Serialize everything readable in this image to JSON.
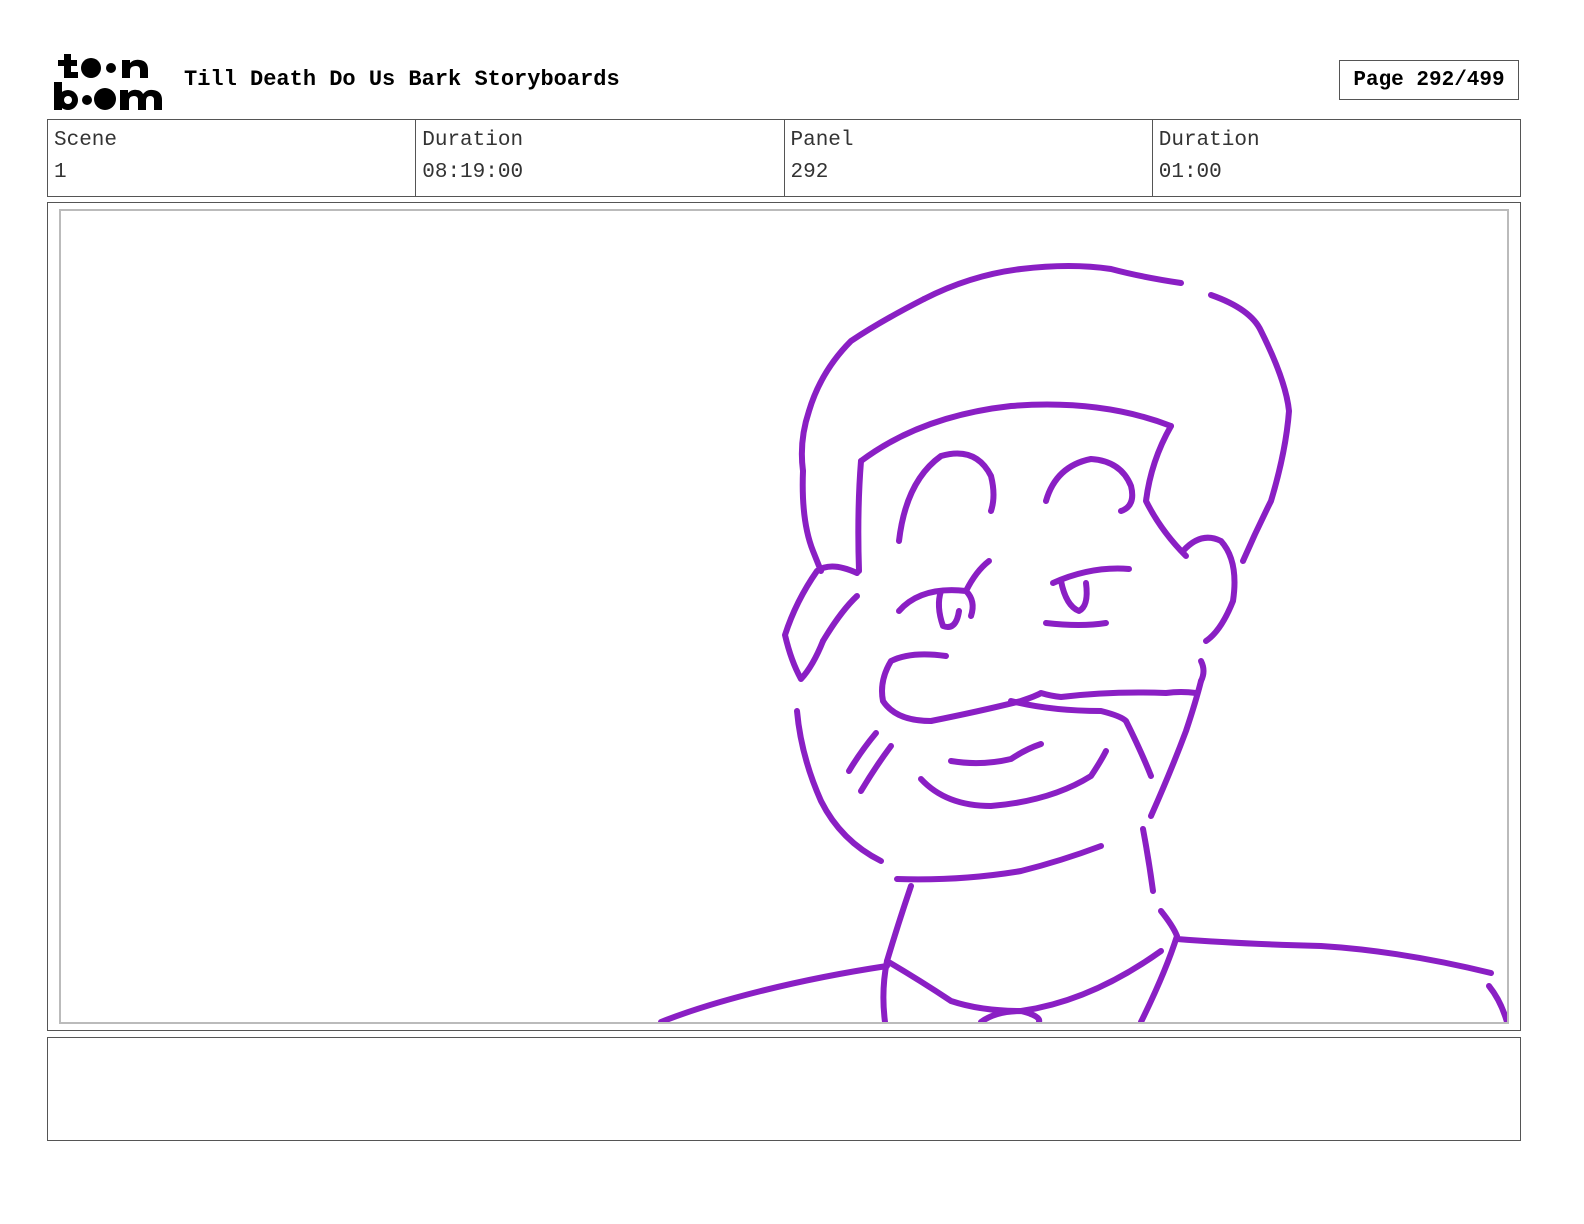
{
  "header": {
    "logo_text": "toon boom",
    "title": "Till Death Do Us Bark Storyboards",
    "page_label": "Page 292/499"
  },
  "info": [
    {
      "label": "Scene",
      "value": "1"
    },
    {
      "label": "Duration",
      "value": "08:19:00"
    },
    {
      "label": "Panel",
      "value": "292"
    },
    {
      "label": "Duration",
      "value": "01:00"
    }
  ],
  "panel": {
    "sketch_color": "#8a1fc4"
  },
  "notes": {
    "text": ""
  }
}
